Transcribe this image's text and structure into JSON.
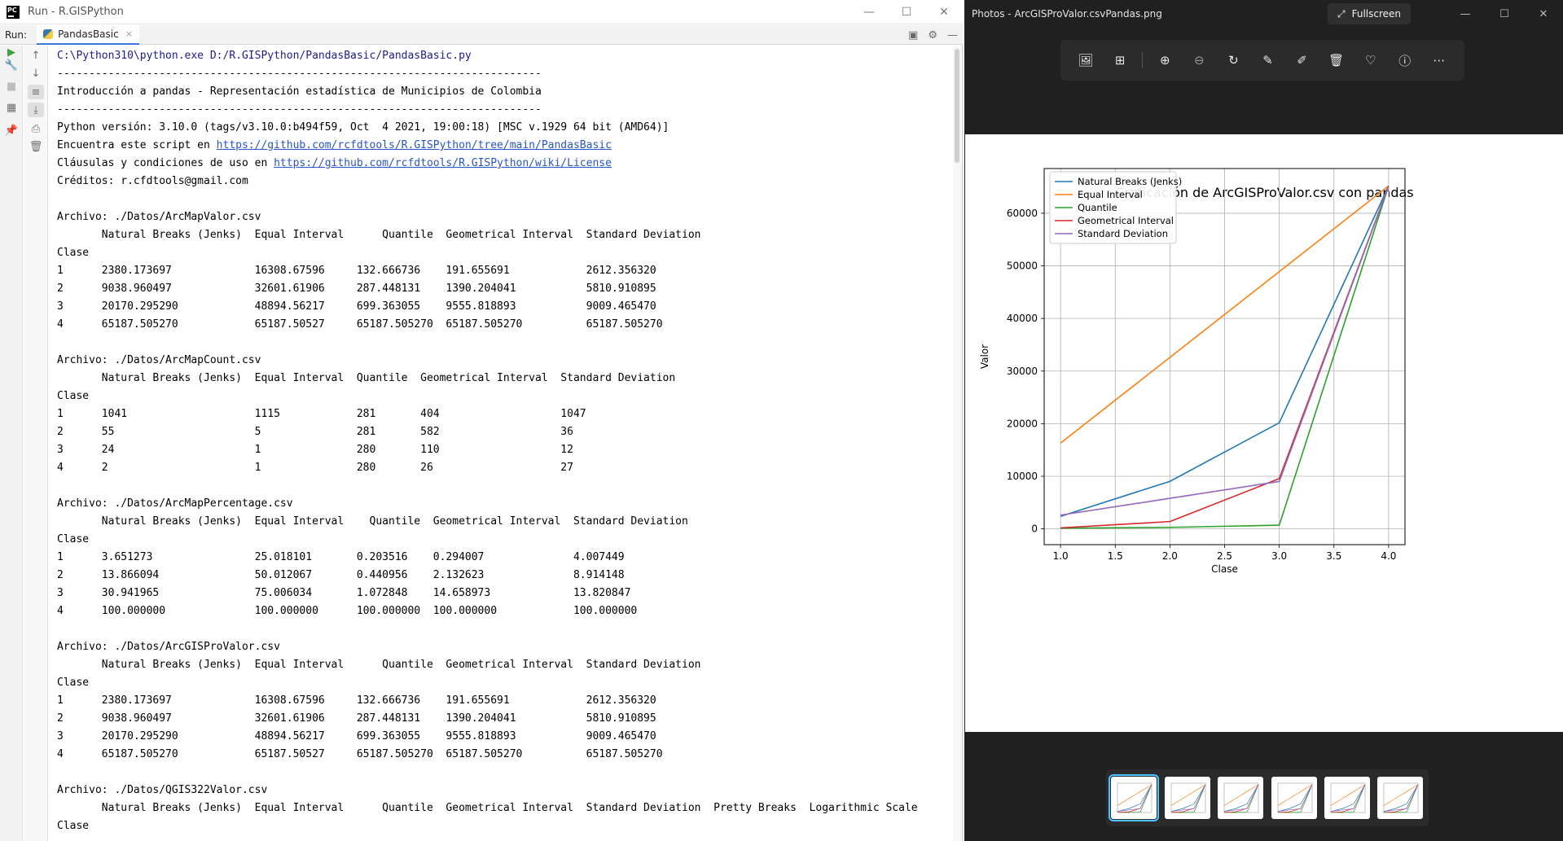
{
  "pycharm": {
    "title": "Run - R.GISPython",
    "run_label": "Run:",
    "tab_label": "PandasBasic",
    "tab_close": "×",
    "min": "—",
    "max": "☐",
    "close": "✕"
  },
  "console": {
    "lines": [
      "C:\\Python310\\python.exe D:/R.GISPython/PandasBasic/PandasBasic.py",
      "----------------------------------------------------------------------------",
      "Introducción a pandas - Representación estadística de Municipios de Colombia",
      "----------------------------------------------------------------------------",
      "Python versión: 3.10.0 (tags/v3.10.0:b494f59, Oct  4 2021, 19:00:18) [MSC v.1929 64 bit (AMD64)]",
      "Encuentra este script en https://github.com/rcfdtools/R.GISPython/tree/main/PandasBasic",
      "Cláusulas y condiciones de uso en https://github.com/rcfdtools/R.GISPython/wiki/License",
      "Créditos: r.cfdtools@gmail.com",
      "",
      "Archivo: ./Datos/ArcMapValor.csv",
      "       Natural Breaks (Jenks)  Equal Interval      Quantile  Geometrical Interval  Standard Deviation",
      "Clase",
      "1      2380.173697             16308.67596     132.666736    191.655691            2612.356320",
      "2      9038.960497             32601.61906     287.448131    1390.204041           5810.910895",
      "3      20170.295290            48894.56217     699.363055    9555.818893           9009.465470",
      "4      65187.505270            65187.50527     65187.505270  65187.505270          65187.505270",
      "",
      "Archivo: ./Datos/ArcMapCount.csv",
      "       Natural Breaks (Jenks)  Equal Interval  Quantile  Geometrical Interval  Standard Deviation",
      "Clase",
      "1      1041                    1115            281       404                   1047",
      "2      55                      5               281       582                   36",
      "3      24                      1               280       110                   12",
      "4      2                       1               280       26                    27",
      "",
      "Archivo: ./Datos/ArcMapPercentage.csv",
      "       Natural Breaks (Jenks)  Equal Interval    Quantile  Geometrical Interval  Standard Deviation",
      "Clase",
      "1      3.651273                25.018101       0.203516    0.294007              4.007449",
      "2      13.866094               50.012067       0.440956    2.132623              8.914148",
      "3      30.941965               75.006034       1.072848    14.658973             13.820847",
      "4      100.000000              100.000000      100.000000  100.000000            100.000000",
      "",
      "Archivo: ./Datos/ArcGISProValor.csv",
      "       Natural Breaks (Jenks)  Equal Interval      Quantile  Geometrical Interval  Standard Deviation",
      "Clase",
      "1      2380.173697             16308.67596     132.666736    191.655691            2612.356320",
      "2      9038.960497             32601.61906     287.448131    1390.204041           5810.910895",
      "3      20170.295290            48894.56217     699.363055    9555.818893           9009.465470",
      "4      65187.505270            65187.50527     65187.505270  65187.505270          65187.505270",
      "",
      "Archivo: ./Datos/QGIS322Valor.csv",
      "       Natural Breaks (Jenks)  Equal Interval      Quantile  Geometrical Interval  Standard Deviation  Pretty Breaks  Logarithmic Scale",
      "Clase"
    ]
  },
  "photos": {
    "title": "Photos - ArcGISProValor.csvPandas.png",
    "fullscreen_label": "Fullscreen",
    "min": "—",
    "max": "☐",
    "close": "✕",
    "tools": [
      "image-icon",
      "grid-icon",
      "zoom-in-icon",
      "zoom-out-icon",
      "rotate-icon",
      "edit-image-icon",
      "draw-icon",
      "delete-icon",
      "heart-icon",
      "info-icon",
      "more-icon"
    ]
  },
  "chart_data": {
    "type": "line",
    "title": "Graficación de ArcGISProValor.csv con pandas",
    "xlabel": "Clase",
    "ylabel": "Valor",
    "x": [
      1,
      2,
      3,
      4
    ],
    "xlim": [
      0.85,
      4.15
    ],
    "ylim": [
      -3000,
      68500
    ],
    "xticks": [
      "1.0",
      "1.5",
      "2.0",
      "2.5",
      "3.0",
      "3.5",
      "4.0"
    ],
    "xtick_values": [
      1.0,
      1.5,
      2.0,
      2.5,
      3.0,
      3.5,
      4.0
    ],
    "yticks": [
      "0",
      "10000",
      "20000",
      "30000",
      "40000",
      "50000",
      "60000"
    ],
    "ytick_values": [
      0,
      10000,
      20000,
      30000,
      40000,
      50000,
      60000
    ],
    "grid": true,
    "legend": "upper-left",
    "series": [
      {
        "name": "Natural Breaks (Jenks)",
        "color": "#1f77b4",
        "values": [
          2380.173697,
          9038.960497,
          20170.29529,
          65187.50527
        ]
      },
      {
        "name": "Equal Interval",
        "color": "#ff7f0e",
        "values": [
          16308.67596,
          32601.61906,
          48894.56217,
          65187.50527
        ]
      },
      {
        "name": "Quantile",
        "color": "#2ca02c",
        "values": [
          132.666736,
          287.448131,
          699.363055,
          65187.50527
        ]
      },
      {
        "name": "Geometrical Interval",
        "color": "#d62728",
        "values": [
          191.655691,
          1390.204041,
          9555.818893,
          65187.50527
        ]
      },
      {
        "name": "Standard Deviation",
        "color": "#9467bd",
        "values": [
          2612.35632,
          5810.910895,
          9009.46547,
          65187.50527
        ]
      }
    ]
  }
}
